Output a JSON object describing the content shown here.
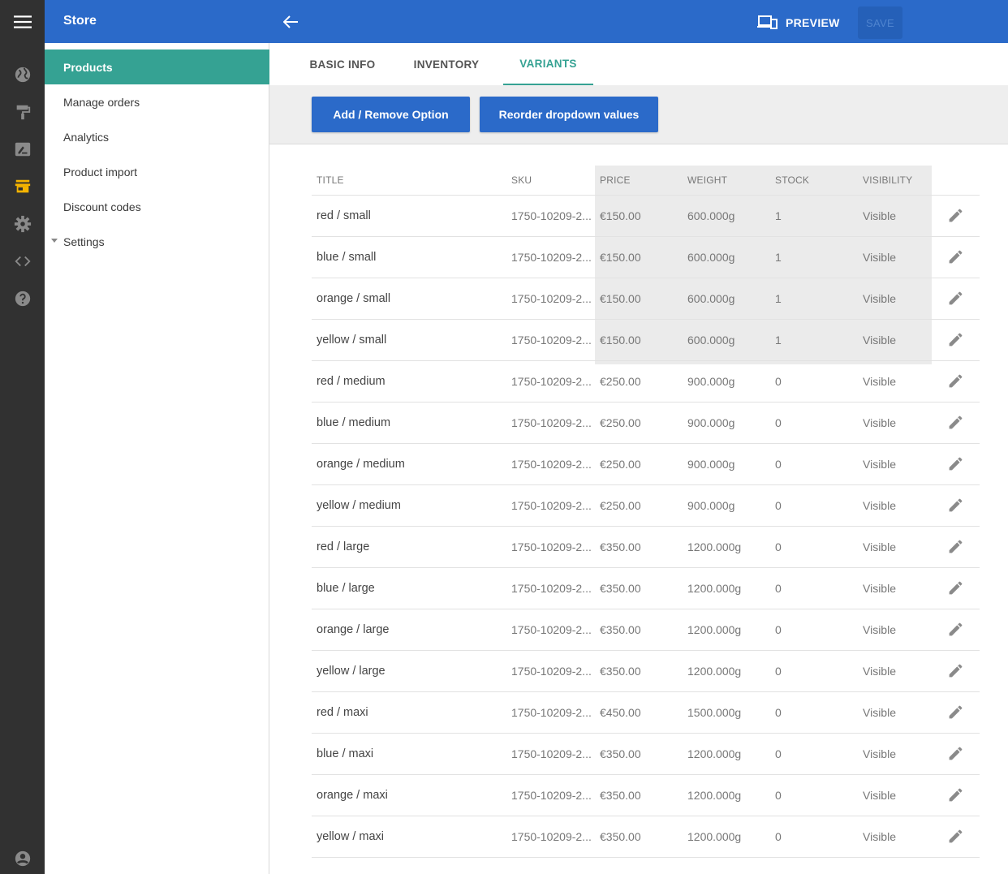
{
  "colors": {
    "primary": "#2b6ac9",
    "accent": "#35a293",
    "rail": "#313131"
  },
  "rail": {
    "icons": [
      "menu-icon",
      "globe-icon",
      "paint-roller-icon",
      "draw-icon",
      "store-icon",
      "gear-icon",
      "code-icon",
      "help-icon",
      "account-icon"
    ]
  },
  "header": {
    "title": "Store",
    "preview_label": "PREVIEW",
    "save_label": "SAVE"
  },
  "sidebar": {
    "items": [
      {
        "label": "Products"
      },
      {
        "label": "Manage orders"
      },
      {
        "label": "Analytics"
      },
      {
        "label": "Product import"
      },
      {
        "label": "Discount codes"
      },
      {
        "label": "Settings"
      }
    ]
  },
  "tabs": [
    {
      "label": "BASIC INFO"
    },
    {
      "label": "INVENTORY"
    },
    {
      "label": "VARIANTS"
    }
  ],
  "actions": {
    "add_remove": "Add / Remove Option",
    "reorder": "Reorder dropdown values"
  },
  "table": {
    "headers": {
      "title": "TITLE",
      "sku": "SKU",
      "price": "PRICE",
      "weight": "WEIGHT",
      "stock": "STOCK",
      "visibility": "VISIBILITY"
    },
    "rows": [
      {
        "title": "red / small",
        "sku": "1750-10209-2...",
        "price": "€150.00",
        "weight": "600.000g",
        "stock": "1",
        "visibility": "Visible"
      },
      {
        "title": "blue / small",
        "sku": "1750-10209-2...",
        "price": "€150.00",
        "weight": "600.000g",
        "stock": "1",
        "visibility": "Visible"
      },
      {
        "title": "orange / small",
        "sku": "1750-10209-2...",
        "price": "€150.00",
        "weight": "600.000g",
        "stock": "1",
        "visibility": "Visible"
      },
      {
        "title": "yellow / small",
        "sku": "1750-10209-2...",
        "price": "€150.00",
        "weight": "600.000g",
        "stock": "1",
        "visibility": "Visible"
      },
      {
        "title": "red / medium",
        "sku": "1750-10209-2...",
        "price": "€250.00",
        "weight": "900.000g",
        "stock": "0",
        "visibility": "Visible"
      },
      {
        "title": "blue / medium",
        "sku": "1750-10209-2...",
        "price": "€250.00",
        "weight": "900.000g",
        "stock": "0",
        "visibility": "Visible"
      },
      {
        "title": "orange / medium",
        "sku": "1750-10209-2...",
        "price": "€250.00",
        "weight": "900.000g",
        "stock": "0",
        "visibility": "Visible"
      },
      {
        "title": "yellow / medium",
        "sku": "1750-10209-2...",
        "price": "€250.00",
        "weight": "900.000g",
        "stock": "0",
        "visibility": "Visible"
      },
      {
        "title": "red / large",
        "sku": "1750-10209-2...",
        "price": "€350.00",
        "weight": "1200.000g",
        "stock": "0",
        "visibility": "Visible"
      },
      {
        "title": "blue / large",
        "sku": "1750-10209-2...",
        "price": "€350.00",
        "weight": "1200.000g",
        "stock": "0",
        "visibility": "Visible"
      },
      {
        "title": "orange / large",
        "sku": "1750-10209-2...",
        "price": "€350.00",
        "weight": "1200.000g",
        "stock": "0",
        "visibility": "Visible"
      },
      {
        "title": "yellow / large",
        "sku": "1750-10209-2...",
        "price": "€350.00",
        "weight": "1200.000g",
        "stock": "0",
        "visibility": "Visible"
      },
      {
        "title": "red / maxi",
        "sku": "1750-10209-2...",
        "price": "€450.00",
        "weight": "1500.000g",
        "stock": "0",
        "visibility": "Visible"
      },
      {
        "title": "blue / maxi",
        "sku": "1750-10209-2...",
        "price": "€350.00",
        "weight": "1200.000g",
        "stock": "0",
        "visibility": "Visible"
      },
      {
        "title": "orange / maxi",
        "sku": "1750-10209-2...",
        "price": "€350.00",
        "weight": "1200.000g",
        "stock": "0",
        "visibility": "Visible"
      },
      {
        "title": "yellow / maxi",
        "sku": "1750-10209-2...",
        "price": "€350.00",
        "weight": "1200.000g",
        "stock": "0",
        "visibility": "Visible"
      }
    ]
  }
}
